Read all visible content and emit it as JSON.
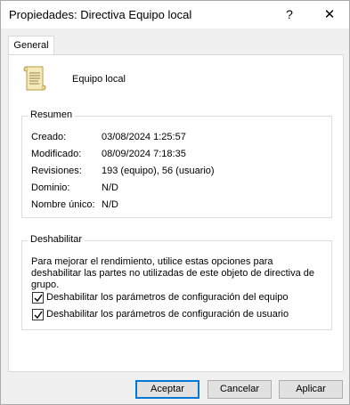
{
  "window": {
    "title": "Propiedades: Directiva Equipo local",
    "help_glyph": "?",
    "close_glyph": "✕"
  },
  "tabs": [
    {
      "label": "General",
      "selected": true
    }
  ],
  "header": {
    "icon": "policy-scroll-icon",
    "name": "Equipo local"
  },
  "summary": {
    "title": "Resumen",
    "rows": [
      {
        "key": "Creado:",
        "value": "03/08/2024 1:25:57"
      },
      {
        "key": "Modificado:",
        "value": "08/09/2024 7:18:35"
      },
      {
        "key": "Revisiones:",
        "value": "193 (equipo), 56 (usuario)"
      },
      {
        "key": "Dominio:",
        "value": "N/D"
      },
      {
        "key": "Nombre único:",
        "value": "N/D"
      }
    ]
  },
  "disable": {
    "title": "Deshabilitar",
    "description": "Para mejorar el rendimiento, utilice estas opciones para deshabilitar las partes no utilizadas de este objeto de directiva de grupo.",
    "options": [
      {
        "label": "Deshabilitar los parámetros de configuración del equipo",
        "checked": true
      },
      {
        "label": "Deshabilitar los parámetros de configuración de usuario",
        "checked": true
      }
    ]
  },
  "buttons": {
    "ok": "Aceptar",
    "cancel": "Cancelar",
    "apply": "Aplicar"
  },
  "colors": {
    "default_button_border": "#0078d7",
    "window_bg": "#f0f0f0",
    "panel_bg": "#ffffff"
  }
}
